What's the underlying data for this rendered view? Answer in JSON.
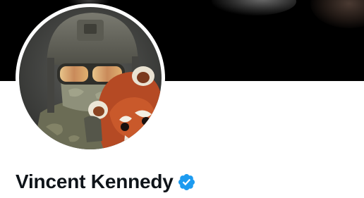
{
  "profile": {
    "display_name": "Vincent Kennedy",
    "verified": true,
    "verified_badge_icon": "verified-badge-icon",
    "avatar_icon": "profile-avatar-photo"
  },
  "colors": {
    "banner": "#000000",
    "page_background": "#ffffff",
    "name_text": "#0f1419",
    "verified_badge": "#1d9bf0"
  }
}
